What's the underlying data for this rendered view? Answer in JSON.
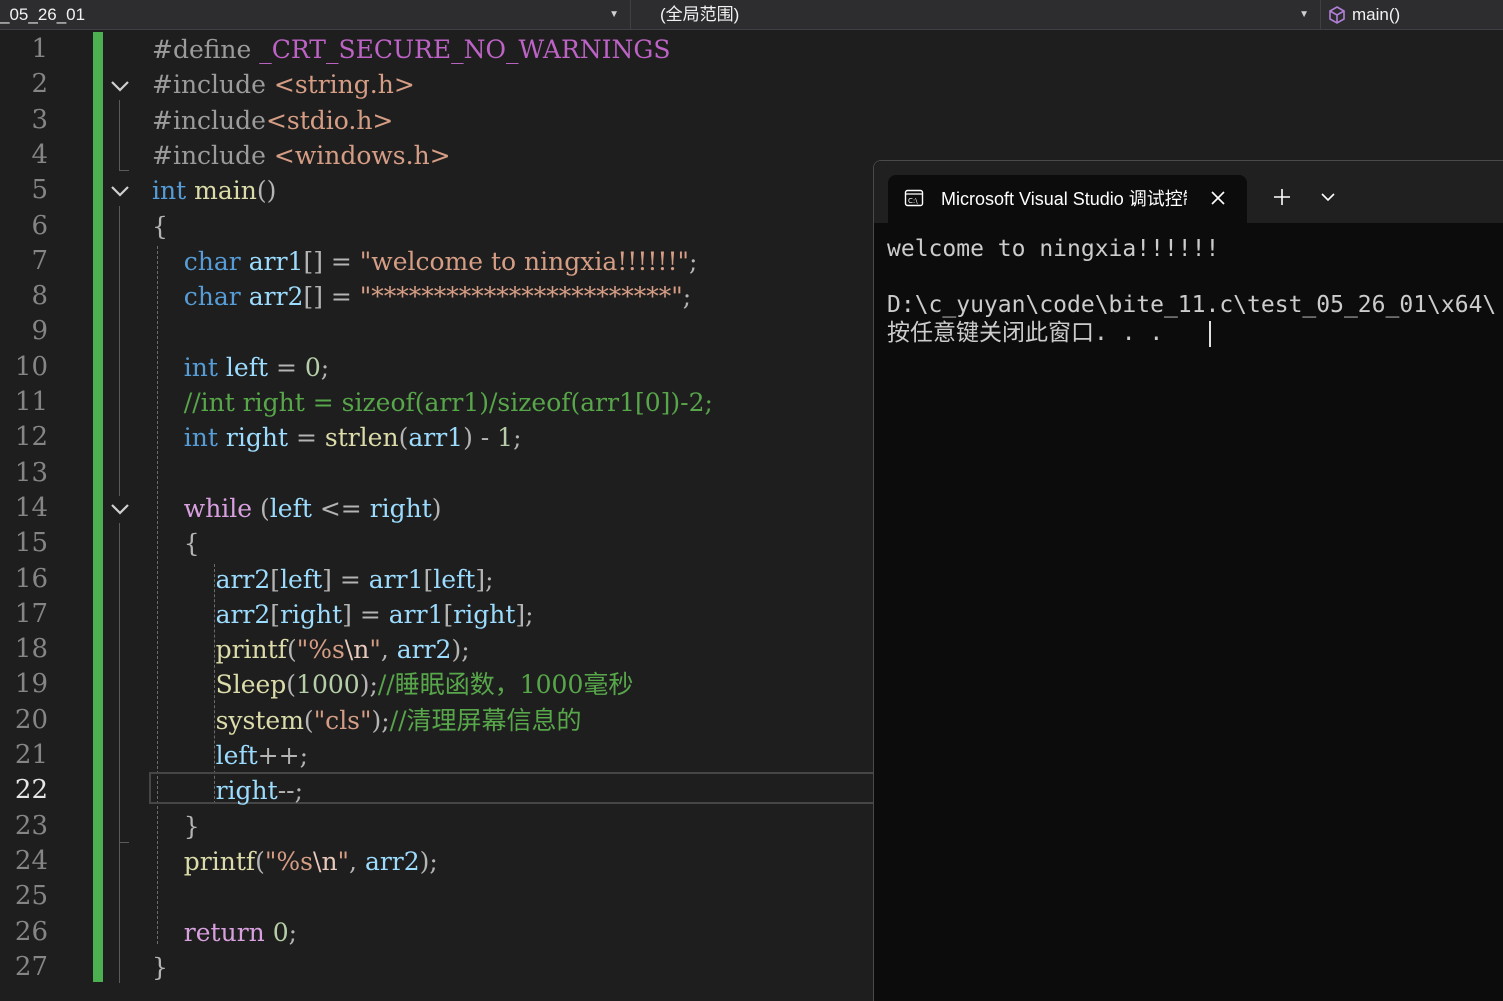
{
  "navbar": {
    "file_combo": "_05_26_01",
    "scope_combo": "(全局范围)",
    "member_combo": "main()"
  },
  "editor": {
    "current_line": 22,
    "line_numbers": [
      "1",
      "2",
      "3",
      "4",
      "5",
      "6",
      "7",
      "8",
      "9",
      "10",
      "11",
      "12",
      "13",
      "14",
      "15",
      "16",
      "17",
      "18",
      "19",
      "20",
      "21",
      "22",
      "23",
      "24",
      "25",
      "26",
      "27"
    ],
    "code": [
      [
        [
          "pp",
          "#define "
        ],
        [
          "macro",
          "_CRT_SECURE_NO_WARNINGS"
        ]
      ],
      [
        [
          "pp",
          "#include "
        ],
        [
          "str",
          "<string.h>"
        ]
      ],
      [
        [
          "pp",
          "#include"
        ],
        [
          "str",
          "<stdio.h>"
        ]
      ],
      [
        [
          "pp",
          "#include "
        ],
        [
          "str",
          "<windows.h>"
        ]
      ],
      [
        [
          "kw",
          "int"
        ],
        [
          "txt",
          " "
        ],
        [
          "fn",
          "main"
        ],
        [
          "punc",
          "()"
        ]
      ],
      [
        [
          "punc",
          "{"
        ]
      ],
      [
        [
          "txt",
          "    "
        ],
        [
          "kw",
          "char"
        ],
        [
          "txt",
          " "
        ],
        [
          "var",
          "arr1"
        ],
        [
          "punc",
          "[] = "
        ],
        [
          "str",
          "\"welcome to ningxia!!!!!!\""
        ],
        [
          "punc",
          ";"
        ]
      ],
      [
        [
          "txt",
          "    "
        ],
        [
          "kw",
          "char"
        ],
        [
          "txt",
          " "
        ],
        [
          "var",
          "arr2"
        ],
        [
          "punc",
          "[] = "
        ],
        [
          "str",
          "\"************************\""
        ],
        [
          "punc",
          ";"
        ]
      ],
      [
        [
          "txt",
          ""
        ]
      ],
      [
        [
          "txt",
          "    "
        ],
        [
          "kw",
          "int"
        ],
        [
          "txt",
          " "
        ],
        [
          "var",
          "left"
        ],
        [
          "punc",
          " = "
        ],
        [
          "num",
          "0"
        ],
        [
          "punc",
          ";"
        ]
      ],
      [
        [
          "txt",
          "    "
        ],
        [
          "com",
          "//int right = sizeof(arr1)/sizeof(arr1[0])-2;"
        ]
      ],
      [
        [
          "txt",
          "    "
        ],
        [
          "kw",
          "int"
        ],
        [
          "txt",
          " "
        ],
        [
          "var",
          "right"
        ],
        [
          "punc",
          " = "
        ],
        [
          "fn",
          "strlen"
        ],
        [
          "punc",
          "("
        ],
        [
          "var",
          "arr1"
        ],
        [
          "punc",
          ") - "
        ],
        [
          "num",
          "1"
        ],
        [
          "punc",
          ";"
        ]
      ],
      [
        [
          "txt",
          ""
        ]
      ],
      [
        [
          "txt",
          "    "
        ],
        [
          "ctl",
          "while"
        ],
        [
          "punc",
          " ("
        ],
        [
          "var",
          "left"
        ],
        [
          "punc",
          " <= "
        ],
        [
          "var",
          "right"
        ],
        [
          "punc",
          ")"
        ]
      ],
      [
        [
          "txt",
          "    "
        ],
        [
          "punc",
          "{"
        ]
      ],
      [
        [
          "txt",
          "        "
        ],
        [
          "var",
          "arr2"
        ],
        [
          "punc",
          "["
        ],
        [
          "var",
          "left"
        ],
        [
          "punc",
          "] = "
        ],
        [
          "var",
          "arr1"
        ],
        [
          "punc",
          "["
        ],
        [
          "var",
          "left"
        ],
        [
          "punc",
          "];"
        ]
      ],
      [
        [
          "txt",
          "        "
        ],
        [
          "var",
          "arr2"
        ],
        [
          "punc",
          "["
        ],
        [
          "var",
          "right"
        ],
        [
          "punc",
          "] = "
        ],
        [
          "var",
          "arr1"
        ],
        [
          "punc",
          "["
        ],
        [
          "var",
          "right"
        ],
        [
          "punc",
          "];"
        ]
      ],
      [
        [
          "txt",
          "        "
        ],
        [
          "fn",
          "printf"
        ],
        [
          "punc",
          "("
        ],
        [
          "str",
          "\"%s"
        ],
        [
          "esc",
          "\\n"
        ],
        [
          "str",
          "\""
        ],
        [
          "punc",
          ", "
        ],
        [
          "var",
          "arr2"
        ],
        [
          "punc",
          ");"
        ]
      ],
      [
        [
          "txt",
          "        "
        ],
        [
          "fn",
          "Sleep"
        ],
        [
          "punc",
          "("
        ],
        [
          "num",
          "1000"
        ],
        [
          "punc",
          ");"
        ],
        [
          "com",
          "//睡眠函数，1000毫秒"
        ]
      ],
      [
        [
          "txt",
          "        "
        ],
        [
          "fn",
          "system"
        ],
        [
          "punc",
          "("
        ],
        [
          "str",
          "\"cls\""
        ],
        [
          "punc",
          ");"
        ],
        [
          "com",
          "//清理屏幕信息的"
        ]
      ],
      [
        [
          "txt",
          "        "
        ],
        [
          "var",
          "left"
        ],
        [
          "punc",
          "++;"
        ]
      ],
      [
        [
          "txt",
          "        "
        ],
        [
          "var",
          "right"
        ],
        [
          "punc",
          "--;"
        ]
      ],
      [
        [
          "txt",
          "    "
        ],
        [
          "punc",
          "}"
        ]
      ],
      [
        [
          "txt",
          "    "
        ],
        [
          "fn",
          "printf"
        ],
        [
          "punc",
          "("
        ],
        [
          "str",
          "\"%s"
        ],
        [
          "esc",
          "\\n"
        ],
        [
          "str",
          "\""
        ],
        [
          "punc",
          ", "
        ],
        [
          "var",
          "arr2"
        ],
        [
          "punc",
          ");"
        ]
      ],
      [
        [
          "txt",
          ""
        ]
      ],
      [
        [
          "txt",
          "    "
        ],
        [
          "ctl",
          "return"
        ],
        [
          "txt",
          " "
        ],
        [
          "num",
          "0"
        ],
        [
          "punc",
          ";"
        ]
      ],
      [
        [
          "punc",
          "}"
        ]
      ]
    ]
  },
  "terminal": {
    "tab_title": "Microsoft Visual Studio 调试控制台",
    "lines": [
      "welcome to ningxia!!!!!!",
      "",
      "D:\\c_yuyan\\code\\bite_11.c\\test_05_26_01\\x64\\",
      "按任意键关闭此窗口. . ."
    ]
  },
  "colors": {
    "editor_bg": "#1e1e1e",
    "keyword": "#569cd6",
    "string": "#d69d85",
    "comment": "#57a64a",
    "change_bar": "#4caf50",
    "terminal_bg": "#0c0c0c"
  }
}
